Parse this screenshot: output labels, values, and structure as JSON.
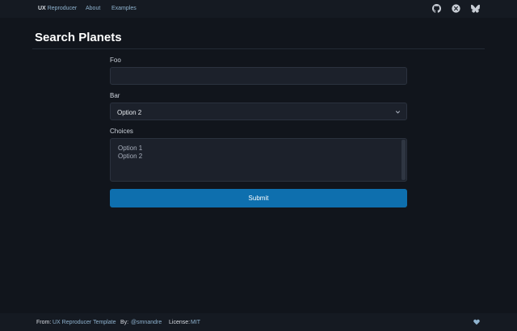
{
  "header": {
    "brand_primary": "UX",
    "brand_secondary": "Reproducer",
    "nav": [
      "About",
      "Examples"
    ],
    "icons": [
      "github-icon",
      "x-twitter-icon",
      "bluesky-icon"
    ]
  },
  "page": {
    "title": "Search Planets"
  },
  "form": {
    "foo_label": "Foo",
    "foo_value": "",
    "bar_label": "Bar",
    "bar_selected": "Option 2",
    "choices_label": "Choices",
    "choices_options": [
      "Option 1",
      "Option 2"
    ],
    "submit_label": "Submit"
  },
  "footer": {
    "from_label": "From:",
    "from_value": "UX Reproducer Template",
    "by_label": "By:",
    "by_value": "@smnandre",
    "license_label": "License:",
    "license_value": "MIT",
    "icon": "heart-icon"
  },
  "colors": {
    "background": "#11151c",
    "accent": "#0e6fae",
    "link": "#8fb3cf"
  }
}
